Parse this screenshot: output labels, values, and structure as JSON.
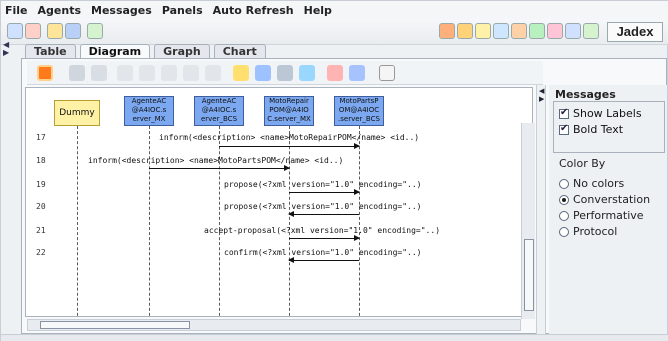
{
  "menubar": {
    "items": [
      "File",
      "Agents",
      "Messages",
      "Panels",
      "Auto Refresh",
      "Help"
    ]
  },
  "toolbar": {
    "logo": "Jadex"
  },
  "tabs": [
    "Table",
    "Diagram",
    "Graph",
    "Chart"
  ],
  "diagram": {
    "nodes": [
      {
        "label": "Dummy"
      },
      {
        "label": "AgenteAC @A4IOC.s erver_MX"
      },
      {
        "label": "AgenteAC @A4IOC.s erver_BCS"
      },
      {
        "label": "MotoRepair POM@A4IO C.server_MX"
      },
      {
        "label": "MotoPartsP OM@A4IOC .server_BCS"
      }
    ],
    "rows": [
      {
        "num": "17",
        "text": "inform(<description> <name>MotoRepairPOM</name> <id..)"
      },
      {
        "num": "18",
        "text": "inform(<description> <name>MotoPartsPOM</name> <id..)"
      },
      {
        "num": "19",
        "text": "propose(<?xml version=\"1.0\" encoding=\"..)"
      },
      {
        "num": "20",
        "text": "propose(<?xml version=\"1.0\" encoding=\"..)"
      },
      {
        "num": "21",
        "text": "accept-proposal(<?xml version=\"1.0\" encoding=\"..)"
      },
      {
        "num": "22",
        "text": "confirm(<?xml version=\"1.0\" encoding=\"..)"
      }
    ]
  },
  "panel": {
    "title": "Messages",
    "show_labels": "Show Labels",
    "bold_text": "Bold Text",
    "color_by": "Color By",
    "options": [
      "No colors",
      "Converstation",
      "Performative",
      "Protocol"
    ],
    "selected": "Converstation"
  },
  "colors": {
    "node_fill": "#7ba8f0",
    "dummy_fill": "#fff2a6"
  }
}
